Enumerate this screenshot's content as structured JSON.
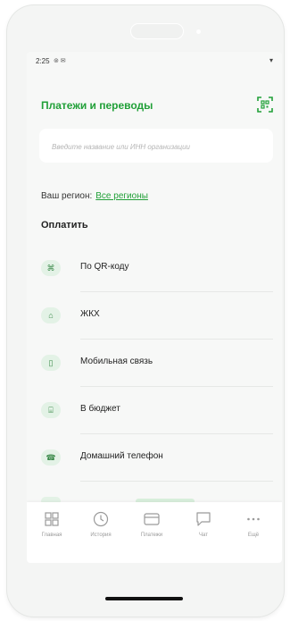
{
  "status": {
    "time": "2:25",
    "icons": "⊚ ✉",
    "wifi": "▾"
  },
  "header": {
    "title": "Платежи и переводы"
  },
  "search": {
    "placeholder": "Введите название или ИНН организации"
  },
  "region": {
    "label": "Ваш регион:",
    "value": "Все регионы"
  },
  "pay": {
    "title": "Оплатить",
    "items": [
      {
        "label": "По QR-коду",
        "icon": "qr-icon",
        "glyph": "⌘"
      },
      {
        "label": "ЖКХ",
        "icon": "home-icon",
        "glyph": "⌂"
      },
      {
        "label": "Мобильная связь",
        "icon": "phone-icon",
        "glyph": "▯"
      },
      {
        "label": "В бюджет",
        "icon": "bank-icon",
        "glyph": "⌸"
      },
      {
        "label": "Домашний телефон",
        "icon": "landline-icon",
        "glyph": "☎"
      }
    ]
  },
  "tabs": [
    {
      "label": "Главная",
      "icon": "grid-icon"
    },
    {
      "label": "История",
      "icon": "clock-icon"
    },
    {
      "label": "Платежи",
      "icon": "card-icon"
    },
    {
      "label": "Чат",
      "icon": "chat-icon"
    },
    {
      "label": "Ещё",
      "icon": "more-icon"
    }
  ],
  "colors": {
    "accent": "#21a038",
    "icon_bg": "#e3f2e6"
  }
}
